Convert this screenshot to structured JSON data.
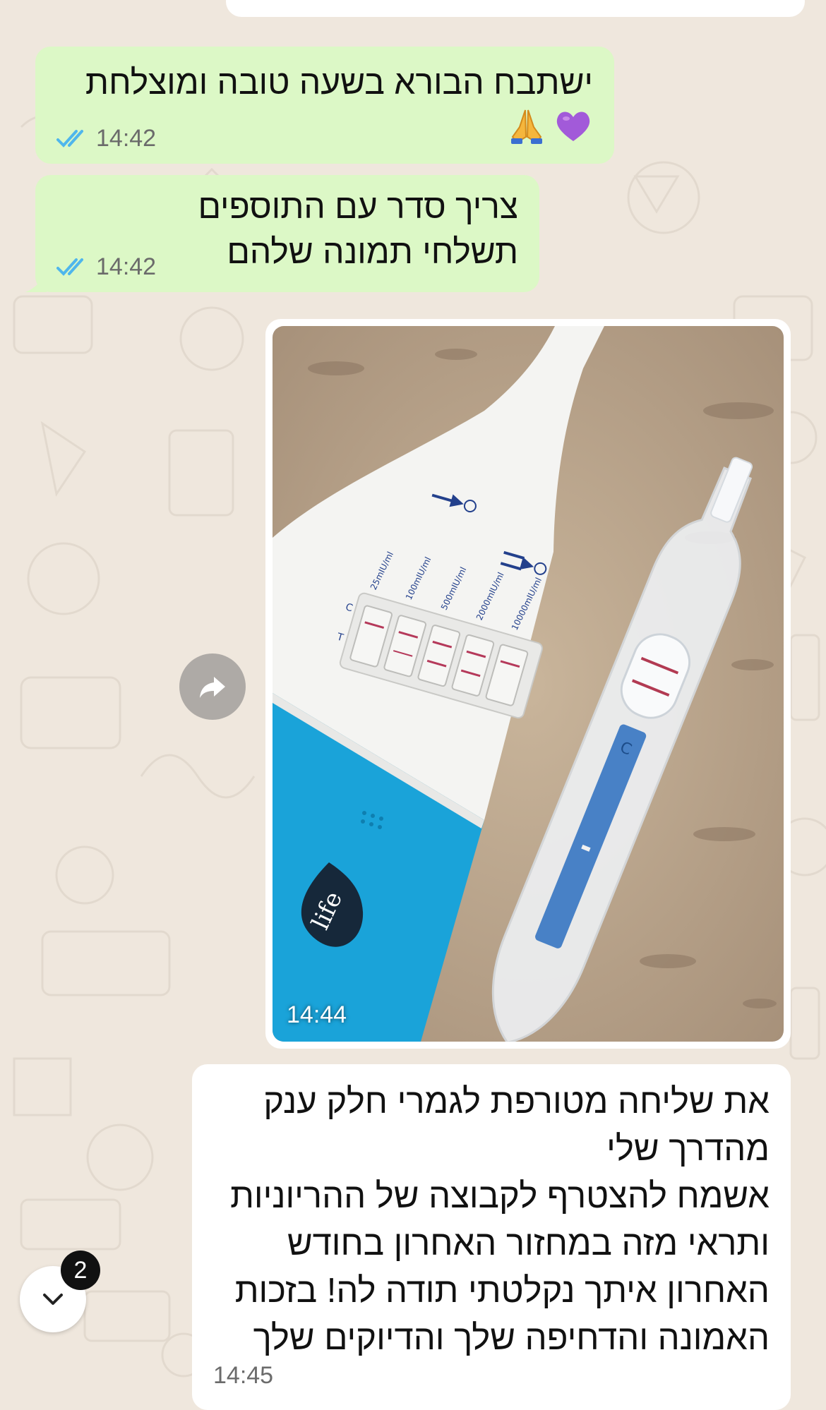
{
  "messages": [
    {
      "direction": "outgoing",
      "lines": [
        "ישתבח הבורא בשעה טובה ומוצלחת"
      ],
      "emojis": [
        "folded-hands",
        "purple-heart"
      ],
      "time": "14:42",
      "status": "read"
    },
    {
      "direction": "outgoing",
      "lines": [
        "צריך סדר עם התוספים",
        "תשלחי תמונה שלהם"
      ],
      "time": "14:42",
      "status": "read"
    },
    {
      "direction": "incoming",
      "type": "image",
      "time": "14:44",
      "image_text": {
        "brand": "life",
        "c_label": "C",
        "t_label": "T",
        "levels": [
          "25mIU/ml",
          "100mIU/ml",
          "500mIU/ml",
          "2000mIU/ml",
          "10000mIU/ml"
        ],
        "stick_c": "C"
      }
    },
    {
      "direction": "incoming",
      "lines": [
        "את שליחה מטורפת לגמרי חלק ענק",
        "מהדרך שלי",
        "אשמח להצטרף לקבוצה של ההריוניות",
        "ותראי מזה במחזור האחרון בחודש",
        "האחרון איתך נקלטתי תודה לה! בזכות",
        "האמונה והדחיפה שלך והדיוקים שלך"
      ],
      "time": "14:45"
    }
  ],
  "scroll_down": {
    "unread_count": "2"
  },
  "colors": {
    "wallpaper": "#efe7dd",
    "outgoing_bubble": "#dcf8c6",
    "incoming_bubble": "#ffffff",
    "read_ticks": "#4fb6ec",
    "test_blue": "#1aa3d9"
  }
}
